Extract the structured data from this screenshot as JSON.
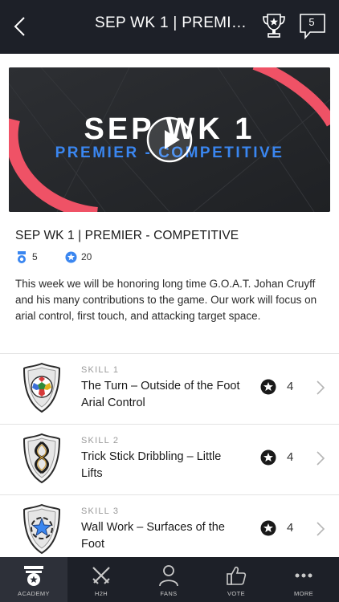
{
  "header": {
    "title": "SEP WK 1 | PREMIER...",
    "message_count": "5"
  },
  "hero": {
    "headline": "SEP WK 1",
    "subheadline": "PREMIER - COMPETITIVE",
    "accent_color": "#3a86f0",
    "ring_color": "#ef5266"
  },
  "info": {
    "title": "SEP WK 1 | PREMIER - COMPETITIVE",
    "stat_skills": "5",
    "stat_points": "20",
    "description": "This week we will be honoring long time G.O.A.T. Johan Cruyff and his many contributions to the game. Our work will focus on arial control, first touch, and attacking target space."
  },
  "skills": [
    {
      "label": "SKILL 1",
      "name": "The Turn – Outside of the Foot Arial Control",
      "points": "4",
      "icon": "soccer-ball-shield-icon"
    },
    {
      "label": "SKILL 2",
      "name": "Trick Stick Dribbling – Little Lifts",
      "points": "4",
      "icon": "laurel-shield-icon"
    },
    {
      "label": "SKILL 3",
      "name": "Wall Work – Surfaces of the Foot",
      "points": "4",
      "icon": "star-shield-icon"
    }
  ],
  "nav": [
    {
      "label": "ACADEMY",
      "icon": "academy-icon",
      "active": true
    },
    {
      "label": "H2H",
      "icon": "crossed-swords-icon",
      "active": false
    },
    {
      "label": "FANS",
      "icon": "person-icon",
      "active": false
    },
    {
      "label": "VOTE",
      "icon": "thumbs-up-icon",
      "active": false
    },
    {
      "label": "MORE",
      "icon": "more-dots-icon",
      "active": false
    }
  ]
}
